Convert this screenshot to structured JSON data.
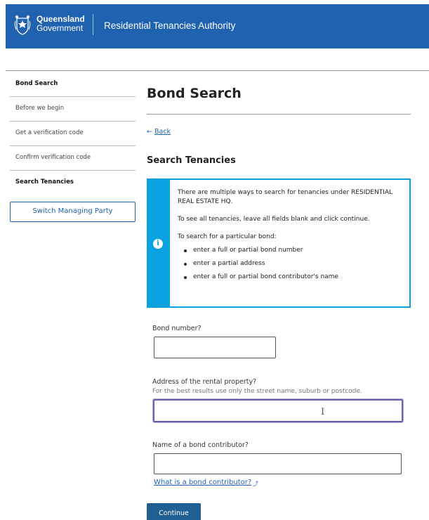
{
  "header": {
    "gov_line1": "Queensland",
    "gov_line2": "Government",
    "title": "Residential Tenancies Authority",
    "color": "#1f62b0"
  },
  "sidebar": {
    "items": [
      {
        "label": "Bond Search"
      },
      {
        "label": "Before we begin"
      },
      {
        "label": "Get a verification code"
      },
      {
        "label": "Confirm verification code"
      },
      {
        "label": "Search Tenancies"
      }
    ],
    "switch_label": "Switch Managing Party"
  },
  "main": {
    "title": "Bond Search",
    "back_arrow": "←",
    "back_label": "Back",
    "section_title": "Search Tenancies",
    "info": {
      "icon": "i",
      "line1": "There are multiple ways to search for tenancies under RESIDENTIAL REAL ESTATE HQ.",
      "line2": "To see all tenancies, leave all fields blank and click continue.",
      "line3": "To search for a particular bond:",
      "bullets": [
        "enter a full or partial bond number",
        "enter a partial address",
        "enter a full or partial bond contributor's name"
      ],
      "accent": "#09a1e0"
    },
    "form": {
      "bond_label": "Bond number?",
      "bond_value": "",
      "address_label": "Address of the rental property?",
      "address_hint": "For the best results use only the street name, suburb or postcode.",
      "address_value": "",
      "cursor_glyph": "I",
      "contributor_label": "Name of a bond contributor?",
      "contributor_value": "",
      "contributor_link": "What is a bond contributor?",
      "ext_glyph": "⤴"
    },
    "continue_label": "Continue"
  }
}
